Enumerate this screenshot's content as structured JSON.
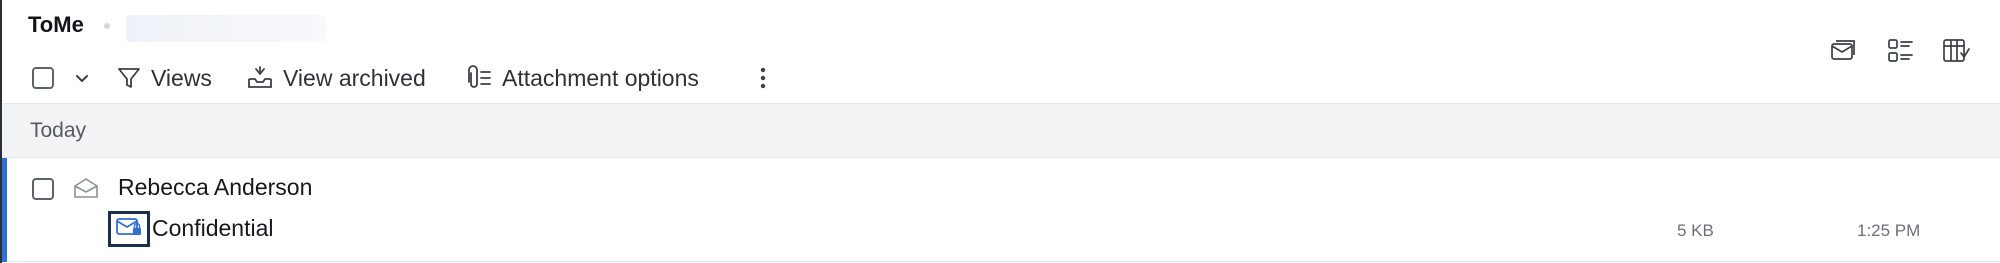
{
  "folder": {
    "title": "ToMe"
  },
  "toolbar": {
    "views_label": "Views",
    "archived_label": "View archived",
    "attachment_label": "Attachment options"
  },
  "icons": {
    "select_all": "checkbox",
    "select_menu": "chevron-down-icon",
    "views": "filter-icon",
    "archived": "archive-tray-icon",
    "attachment": "paperclip-list-icon",
    "more": "vertical-ellipsis-icon",
    "right_1": "reading-pane-icon",
    "right_2": "list-view-icon",
    "right_3": "column-settings-icon"
  },
  "colors": {
    "accent": "#2f6fd6",
    "selected_icon_border": "#1a2e4f",
    "group_bg": "#f2f3f5"
  },
  "groups": [
    {
      "label": "Today",
      "messages": [
        {
          "sender": "Rebecca Anderson",
          "subject": "Confidential",
          "size": "5 KB",
          "time": "1:25 PM",
          "icon": "envelope-lock-icon"
        }
      ]
    }
  ]
}
